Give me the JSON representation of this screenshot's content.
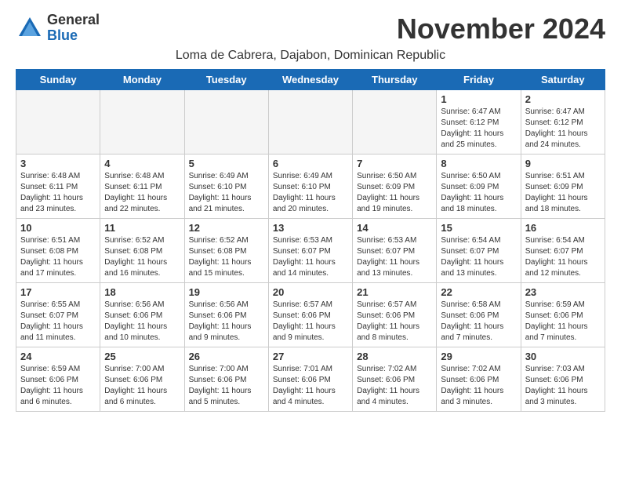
{
  "logo": {
    "general": "General",
    "blue": "Blue"
  },
  "title": "November 2024",
  "subtitle": "Loma de Cabrera, Dajabon, Dominican Republic",
  "headers": [
    "Sunday",
    "Monday",
    "Tuesday",
    "Wednesday",
    "Thursday",
    "Friday",
    "Saturday"
  ],
  "rows": [
    [
      {
        "num": "",
        "info": "",
        "empty": true
      },
      {
        "num": "",
        "info": "",
        "empty": true
      },
      {
        "num": "",
        "info": "",
        "empty": true
      },
      {
        "num": "",
        "info": "",
        "empty": true
      },
      {
        "num": "",
        "info": "",
        "empty": true
      },
      {
        "num": "1",
        "info": "Sunrise: 6:47 AM\nSunset: 6:12 PM\nDaylight: 11 hours\nand 25 minutes.",
        "empty": false
      },
      {
        "num": "2",
        "info": "Sunrise: 6:47 AM\nSunset: 6:12 PM\nDaylight: 11 hours\nand 24 minutes.",
        "empty": false
      }
    ],
    [
      {
        "num": "3",
        "info": "Sunrise: 6:48 AM\nSunset: 6:11 PM\nDaylight: 11 hours\nand 23 minutes.",
        "empty": false
      },
      {
        "num": "4",
        "info": "Sunrise: 6:48 AM\nSunset: 6:11 PM\nDaylight: 11 hours\nand 22 minutes.",
        "empty": false
      },
      {
        "num": "5",
        "info": "Sunrise: 6:49 AM\nSunset: 6:10 PM\nDaylight: 11 hours\nand 21 minutes.",
        "empty": false
      },
      {
        "num": "6",
        "info": "Sunrise: 6:49 AM\nSunset: 6:10 PM\nDaylight: 11 hours\nand 20 minutes.",
        "empty": false
      },
      {
        "num": "7",
        "info": "Sunrise: 6:50 AM\nSunset: 6:09 PM\nDaylight: 11 hours\nand 19 minutes.",
        "empty": false
      },
      {
        "num": "8",
        "info": "Sunrise: 6:50 AM\nSunset: 6:09 PM\nDaylight: 11 hours\nand 18 minutes.",
        "empty": false
      },
      {
        "num": "9",
        "info": "Sunrise: 6:51 AM\nSunset: 6:09 PM\nDaylight: 11 hours\nand 18 minutes.",
        "empty": false
      }
    ],
    [
      {
        "num": "10",
        "info": "Sunrise: 6:51 AM\nSunset: 6:08 PM\nDaylight: 11 hours\nand 17 minutes.",
        "empty": false
      },
      {
        "num": "11",
        "info": "Sunrise: 6:52 AM\nSunset: 6:08 PM\nDaylight: 11 hours\nand 16 minutes.",
        "empty": false
      },
      {
        "num": "12",
        "info": "Sunrise: 6:52 AM\nSunset: 6:08 PM\nDaylight: 11 hours\nand 15 minutes.",
        "empty": false
      },
      {
        "num": "13",
        "info": "Sunrise: 6:53 AM\nSunset: 6:07 PM\nDaylight: 11 hours\nand 14 minutes.",
        "empty": false
      },
      {
        "num": "14",
        "info": "Sunrise: 6:53 AM\nSunset: 6:07 PM\nDaylight: 11 hours\nand 13 minutes.",
        "empty": false
      },
      {
        "num": "15",
        "info": "Sunrise: 6:54 AM\nSunset: 6:07 PM\nDaylight: 11 hours\nand 13 minutes.",
        "empty": false
      },
      {
        "num": "16",
        "info": "Sunrise: 6:54 AM\nSunset: 6:07 PM\nDaylight: 11 hours\nand 12 minutes.",
        "empty": false
      }
    ],
    [
      {
        "num": "17",
        "info": "Sunrise: 6:55 AM\nSunset: 6:07 PM\nDaylight: 11 hours\nand 11 minutes.",
        "empty": false
      },
      {
        "num": "18",
        "info": "Sunrise: 6:56 AM\nSunset: 6:06 PM\nDaylight: 11 hours\nand 10 minutes.",
        "empty": false
      },
      {
        "num": "19",
        "info": "Sunrise: 6:56 AM\nSunset: 6:06 PM\nDaylight: 11 hours\nand 9 minutes.",
        "empty": false
      },
      {
        "num": "20",
        "info": "Sunrise: 6:57 AM\nSunset: 6:06 PM\nDaylight: 11 hours\nand 9 minutes.",
        "empty": false
      },
      {
        "num": "21",
        "info": "Sunrise: 6:57 AM\nSunset: 6:06 PM\nDaylight: 11 hours\nand 8 minutes.",
        "empty": false
      },
      {
        "num": "22",
        "info": "Sunrise: 6:58 AM\nSunset: 6:06 PM\nDaylight: 11 hours\nand 7 minutes.",
        "empty": false
      },
      {
        "num": "23",
        "info": "Sunrise: 6:59 AM\nSunset: 6:06 PM\nDaylight: 11 hours\nand 7 minutes.",
        "empty": false
      }
    ],
    [
      {
        "num": "24",
        "info": "Sunrise: 6:59 AM\nSunset: 6:06 PM\nDaylight: 11 hours\nand 6 minutes.",
        "empty": false
      },
      {
        "num": "25",
        "info": "Sunrise: 7:00 AM\nSunset: 6:06 PM\nDaylight: 11 hours\nand 6 minutes.",
        "empty": false
      },
      {
        "num": "26",
        "info": "Sunrise: 7:00 AM\nSunset: 6:06 PM\nDaylight: 11 hours\nand 5 minutes.",
        "empty": false
      },
      {
        "num": "27",
        "info": "Sunrise: 7:01 AM\nSunset: 6:06 PM\nDaylight: 11 hours\nand 4 minutes.",
        "empty": false
      },
      {
        "num": "28",
        "info": "Sunrise: 7:02 AM\nSunset: 6:06 PM\nDaylight: 11 hours\nand 4 minutes.",
        "empty": false
      },
      {
        "num": "29",
        "info": "Sunrise: 7:02 AM\nSunset: 6:06 PM\nDaylight: 11 hours\nand 3 minutes.",
        "empty": false
      },
      {
        "num": "30",
        "info": "Sunrise: 7:03 AM\nSunset: 6:06 PM\nDaylight: 11 hours\nand 3 minutes.",
        "empty": false
      }
    ]
  ]
}
